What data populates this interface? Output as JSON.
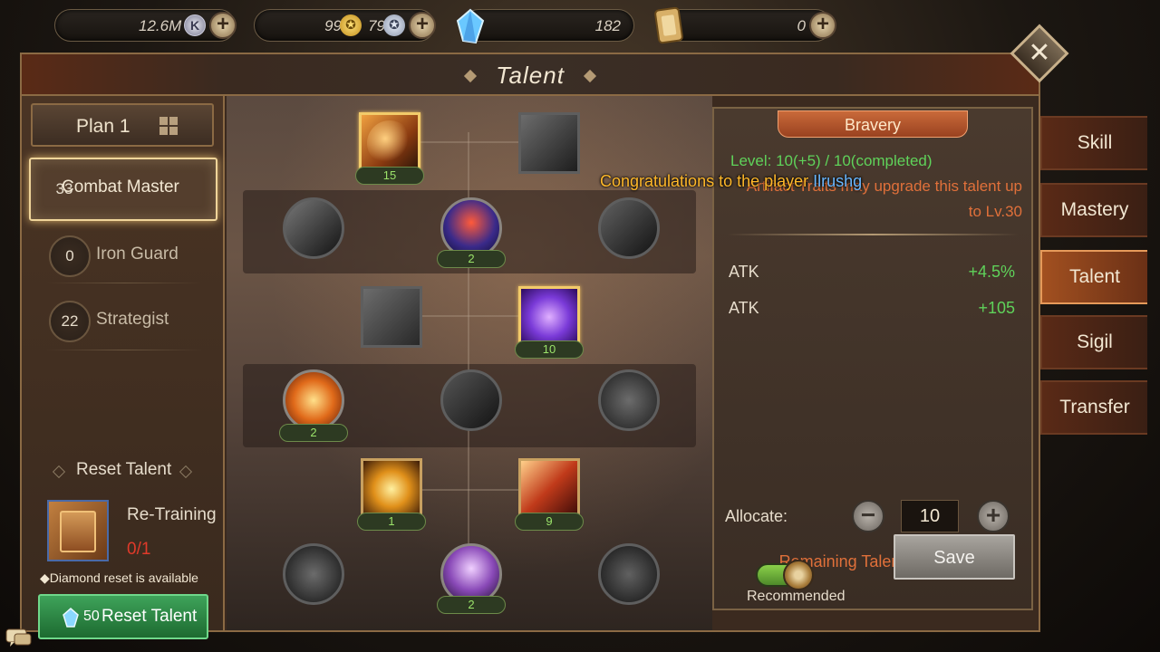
{
  "top_bar": {
    "gold_amount": "12.6M",
    "coin_a_amount": "99",
    "coin_b_amount": "79",
    "crystal_amount": "182",
    "card_amount": "0"
  },
  "panel": {
    "title": "Talent"
  },
  "left": {
    "plan_label": "Plan 1",
    "trees": [
      {
        "points": "33",
        "name": "Combat Master"
      },
      {
        "points": "0",
        "name": "Iron Guard"
      },
      {
        "points": "22",
        "name": "Strategist"
      }
    ],
    "reset_title": "Reset Talent",
    "retrain_label": "Re-Training",
    "retrain_count": "0/1",
    "diamond_note": "◆Diamond reset is available",
    "reset_cost": "50",
    "reset_button": "Reset Talent"
  },
  "tree_nodes": {
    "n1": "15",
    "n2": "2",
    "n3": "10",
    "n4": "2",
    "n5": "1",
    "n6": "9",
    "n7": "2"
  },
  "detail": {
    "name": "Bravery",
    "level": "Level: 10(+5) / 10(completed)",
    "trait_note": "Artifact Traits may upgrade this talent up to Lv.30",
    "stats": [
      {
        "label": "ATK",
        "value": "+4.5%"
      },
      {
        "label": "ATK",
        "value": "+105"
      }
    ],
    "allocate_label": "Allocate:",
    "allocate_value": "10",
    "remaining": "Remaining Talent points:0",
    "recommended_label": "Recommended",
    "recommended_on": true,
    "save_label": "Save"
  },
  "tabs": [
    "Skill",
    "Mastery",
    "Talent",
    "Sigil",
    "Transfer"
  ],
  "active_tab": "Talent",
  "toast": {
    "prefix": "Congratulations to the player ",
    "player": "Ilrushg"
  },
  "icons": {
    "close": "close-icon",
    "plus": "plus-icon",
    "minus": "minus-icon",
    "grid": "grid-icon",
    "crystal": "crystal-icon",
    "card": "card-icon",
    "chat": "chat-icon"
  }
}
